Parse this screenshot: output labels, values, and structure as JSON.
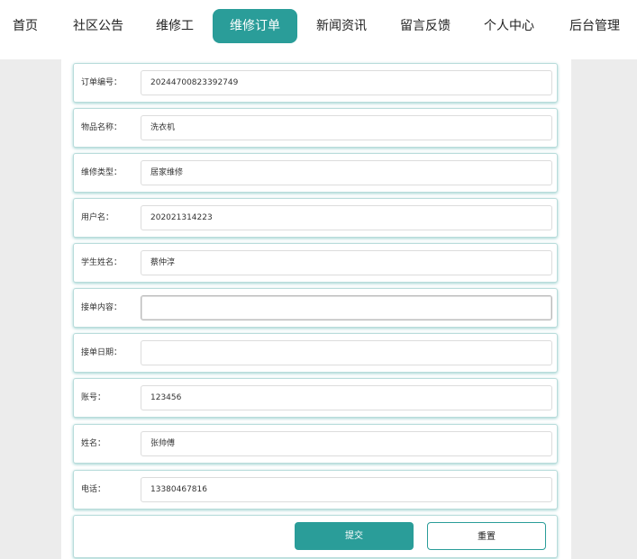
{
  "nav": {
    "items": [
      {
        "label": "首页"
      },
      {
        "label": "社区公告"
      },
      {
        "label": "维修工"
      },
      {
        "label": "维修订单",
        "active": true
      },
      {
        "label": "新闻资讯"
      },
      {
        "label": "留言反馈"
      },
      {
        "label": "个人中心"
      },
      {
        "label": "后台管理"
      }
    ],
    "active_color": "#2a9d99"
  },
  "form": {
    "fields": [
      {
        "label": "订单编号：",
        "value": "20244700823392749"
      },
      {
        "label": "物品名称：",
        "value": "洗衣机"
      },
      {
        "label": "维修类型：",
        "value": "居家维修"
      },
      {
        "label": "用户名：",
        "value": "202021314223"
      },
      {
        "label": "学生姓名：",
        "value": "蔡仲淳"
      },
      {
        "label": "接单内容：",
        "value": ""
      },
      {
        "label": "接单日期：",
        "value": ""
      },
      {
        "label": "账号：",
        "value": "123456"
      },
      {
        "label": "姓名：",
        "value": "张帅傅"
      },
      {
        "label": "电话：",
        "value": "13380467816"
      }
    ],
    "submit_label": "提交",
    "reset_label": "重置"
  }
}
